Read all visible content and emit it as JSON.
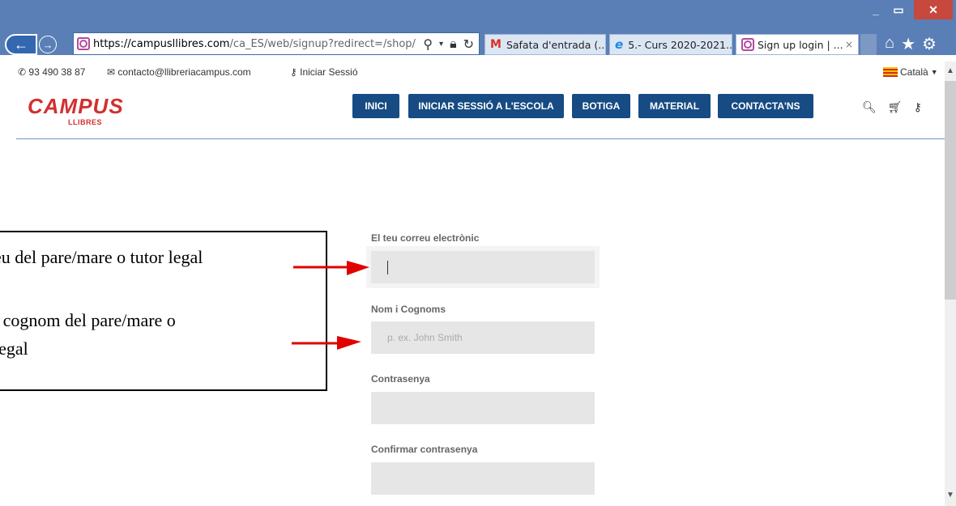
{
  "browser": {
    "url_scheme": "https://",
    "url_host": "campusllibres.com",
    "url_path": "/ca_ES/web/signup?redirect=/shop/",
    "tabs": [
      {
        "label": "Safata d'entrada (...",
        "icon": "gmail-icon"
      },
      {
        "label": "5.- Curs 2020-2021...",
        "icon": "ie-icon"
      },
      {
        "label": "Sign up login | ...",
        "icon": "site-icon",
        "active": true
      }
    ],
    "tab_close": "×",
    "window_min": "_",
    "window_max": "▭",
    "window_close": "✕"
  },
  "topbar": {
    "phone": "93 490 38 87",
    "email": "contacto@llibreriacampus.com",
    "login": "Iniciar Sessió",
    "language": "Català"
  },
  "header": {
    "logo_main": "CAMPUS",
    "logo_sub": "LLIBRES",
    "nav": [
      "INICI",
      "INICIAR SESSIÓ A L'ESCOLA",
      "BOTIGA",
      "MATERIAL",
      "CONTACTA'NS"
    ]
  },
  "form": {
    "email_label": "El teu correu electrònic",
    "email_value": "",
    "name_label": "Nom i Cognoms",
    "name_placeholder": "p. ex. John Smith",
    "password_label": "Contrasenya",
    "confirm_label": "Confirmar contrasenya"
  },
  "annotation": {
    "line1": "eu del pare/mare o tutor legal",
    "line2": "i cognom del pare/mare o",
    "line3": "legal"
  },
  "colors": {
    "nav_bg": "#164b83",
    "logo_red": "#d32f2f",
    "chrome_blue": "#5a7fb6",
    "field_bg": "#e6e6e6",
    "arrow_red": "#e00000"
  }
}
